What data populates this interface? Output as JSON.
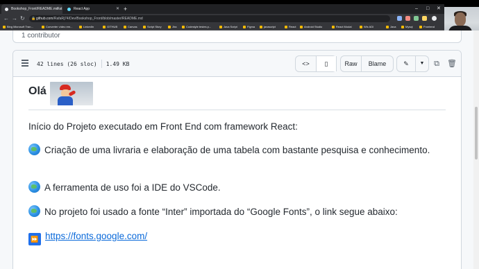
{
  "browser": {
    "tabs": [
      {
        "label": "Bookshop_Front/README.md at"
      },
      {
        "label": "React App"
      }
    ],
    "url_host": "github.com",
    "url_path": "/RafaRj74/Dev/Bookshop_Front/blob/master/README.md",
    "bookmarks": [
      "Bing Microsoft Tran...",
      "Converter vídeo em...",
      "LinkedIn",
      "GITHUB",
      "Canvas",
      "Script Story",
      "Jira",
      "Codestyle testes p...",
      "Java Script",
      "Figma",
      "javascript",
      "React",
      "Android Studio",
      "React Modal",
      "Wix ADI",
      "Java",
      "Mysql",
      "Frontend"
    ]
  },
  "contributors": {
    "text": "1 contributor"
  },
  "file_header": {
    "lines": "42 lines (26 sloc)",
    "size": "1.49 KB",
    "raw_label": "Raw",
    "blame_label": "Blame"
  },
  "readme": {
    "title": "Olá",
    "intro": "Início do Projeto executado em Front End com framework React:",
    "items": [
      "Criação de uma livraria e elaboração de uma tabela com bastante pesquisa e conhecimento.",
      "A ferramenta de uso foi a IDE do VSCode.",
      "No projeto foi usado a fonte “Inter” importada do “Google Fonts”, o link segue abaixo:"
    ],
    "link": "https://fonts.google.com/"
  },
  "colors": {
    "link": "#0969da",
    "text": "#24292f",
    "border": "#d0d7de"
  }
}
